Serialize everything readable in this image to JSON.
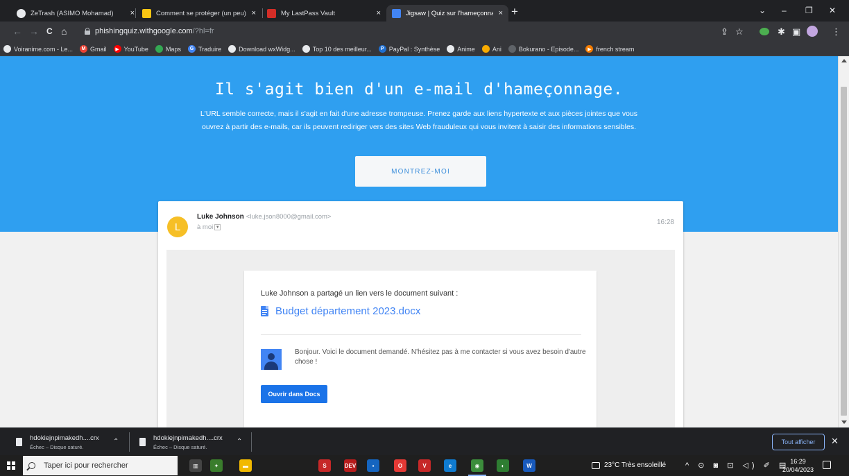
{
  "browser": {
    "tabs": [
      {
        "title": "ZeTrash (ASIMO Mohamad)",
        "icon": "github-icon",
        "color": "#e8eaed"
      },
      {
        "title": "Comment se protéger (un peu) c",
        "icon": "yellow-site-icon",
        "color": "#f9c513"
      },
      {
        "title": "My LastPass Vault",
        "icon": "lastpass-icon",
        "color": "#d32d27"
      },
      {
        "title": "Jigsaw | Quiz sur l'hameçonnage",
        "icon": "jigsaw-icon",
        "color": "#4285f4"
      }
    ],
    "close_glyph": "×",
    "new_tab_glyph": "+",
    "window_controls": {
      "tab_search": "⌄",
      "minimize": "–",
      "restore": "❐",
      "close": "✕"
    },
    "nav": {
      "back": "←",
      "forward": "→",
      "reload": "C",
      "home": "⌂"
    },
    "url_host": "phishingquiz.withgoogle.com",
    "url_path": "/?hl=fr",
    "toolbar_icons": {
      "share": "⇪",
      "star": "☆",
      "extension": "✱",
      "sidebar": "▣",
      "menu": "⋮"
    },
    "bookmarks": [
      {
        "label": "Voiranime.com - Le...",
        "color": "#e8eaed",
        "glyph": ""
      },
      {
        "label": "Gmail",
        "color": "#ea4335",
        "glyph": "M"
      },
      {
        "label": "YouTube",
        "color": "#ff0000",
        "glyph": "▶"
      },
      {
        "label": "Maps",
        "color": "#34a853",
        "glyph": ""
      },
      {
        "label": "Traduire",
        "color": "#4285f4",
        "glyph": "G"
      },
      {
        "label": "Download wxWidg...",
        "color": "#e8eaed",
        "glyph": ""
      },
      {
        "label": "Top 10 des meilleur...",
        "color": "#e8eaed",
        "glyph": ""
      },
      {
        "label": "PayPal : Synthèse",
        "color": "#1f6fd1",
        "glyph": "P"
      },
      {
        "label": "Anime",
        "color": "#e8eaed",
        "glyph": ""
      },
      {
        "label": "Ani",
        "color": "#f9ab00",
        "glyph": ""
      },
      {
        "label": "Bokurano - Episode...",
        "color": "#5f6368",
        "glyph": ""
      },
      {
        "label": "french stream",
        "color": "#f57c00",
        "glyph": "▶"
      }
    ]
  },
  "hero": {
    "title": "Il s'agit bien d'un e-mail d'hameçonnage.",
    "description": "L'URL semble correcte, mais il s'agit en fait d'une adresse trompeuse. Prenez garde aux liens hypertexte et aux pièces jointes que vous ouvrez à partir des e-mails, car ils peuvent rediriger vers des sites Web frauduleux qui vous invitent à saisir des informations sensibles.",
    "button_label": "MONTREZ-MOI",
    "background": "#2f9ff0"
  },
  "email": {
    "avatar_letter": "L",
    "sender_name": "Luke Johnson",
    "sender_address": "<luke.json8000@gmail.com>",
    "recipient": "à moi",
    "time": "16:28",
    "share_text": "Luke Johnson a partagé un lien vers le document suivant :",
    "document_name": "Budget département 2023.docx",
    "message": "Bonjour. Voici le document demandé. N'hésitez pas à me contacter si vous avez besoin d'autre chose !",
    "open_button": "Ouvrir dans Docs"
  },
  "downloads": {
    "items": [
      {
        "name": "hdokiejnpimakedh....crx",
        "status": "Échec – Disque saturé."
      },
      {
        "name": "hdokiejnpimakedh....crx",
        "status": "Échec – Disque saturé."
      }
    ],
    "caret_glyph": "⌃",
    "show_all": "Tout afficher",
    "close_glyph": "✕"
  },
  "taskbar": {
    "search_placeholder": "Taper ici pour rechercher",
    "apps": [
      {
        "name": "task-view",
        "color": "#444444",
        "label": "▥"
      },
      {
        "name": "app-green",
        "color": "#3a7d2c",
        "label": "✦"
      },
      {
        "name": "file-explorer",
        "color": "#f2b900",
        "label": "▬"
      },
      {
        "name": "app-red",
        "color": "#c62828",
        "label": "S"
      },
      {
        "name": "dev-cpp",
        "color": "#b71c1c",
        "label": "DEV"
      },
      {
        "name": "app-blue",
        "color": "#1565c0",
        "label": "▪"
      },
      {
        "name": "opera",
        "color": "#e53935",
        "label": "O"
      },
      {
        "name": "app-v",
        "color": "#c62828",
        "label": "V"
      },
      {
        "name": "edge",
        "color": "#0f7bd0",
        "label": "e"
      },
      {
        "name": "chrome",
        "color": "#3c8d3c",
        "label": "◉"
      },
      {
        "name": "app-colorful",
        "color": "#2e7d32",
        "label": "◐"
      },
      {
        "name": "word",
        "color": "#185abd",
        "label": "W"
      }
    ],
    "weather": "23°C  Très ensoleillé",
    "tray_icons": "^ ⊙ ◙ ⊡ ◁) ✐ ▤",
    "clock_time": "16:29",
    "clock_date": "20/04/2023"
  }
}
